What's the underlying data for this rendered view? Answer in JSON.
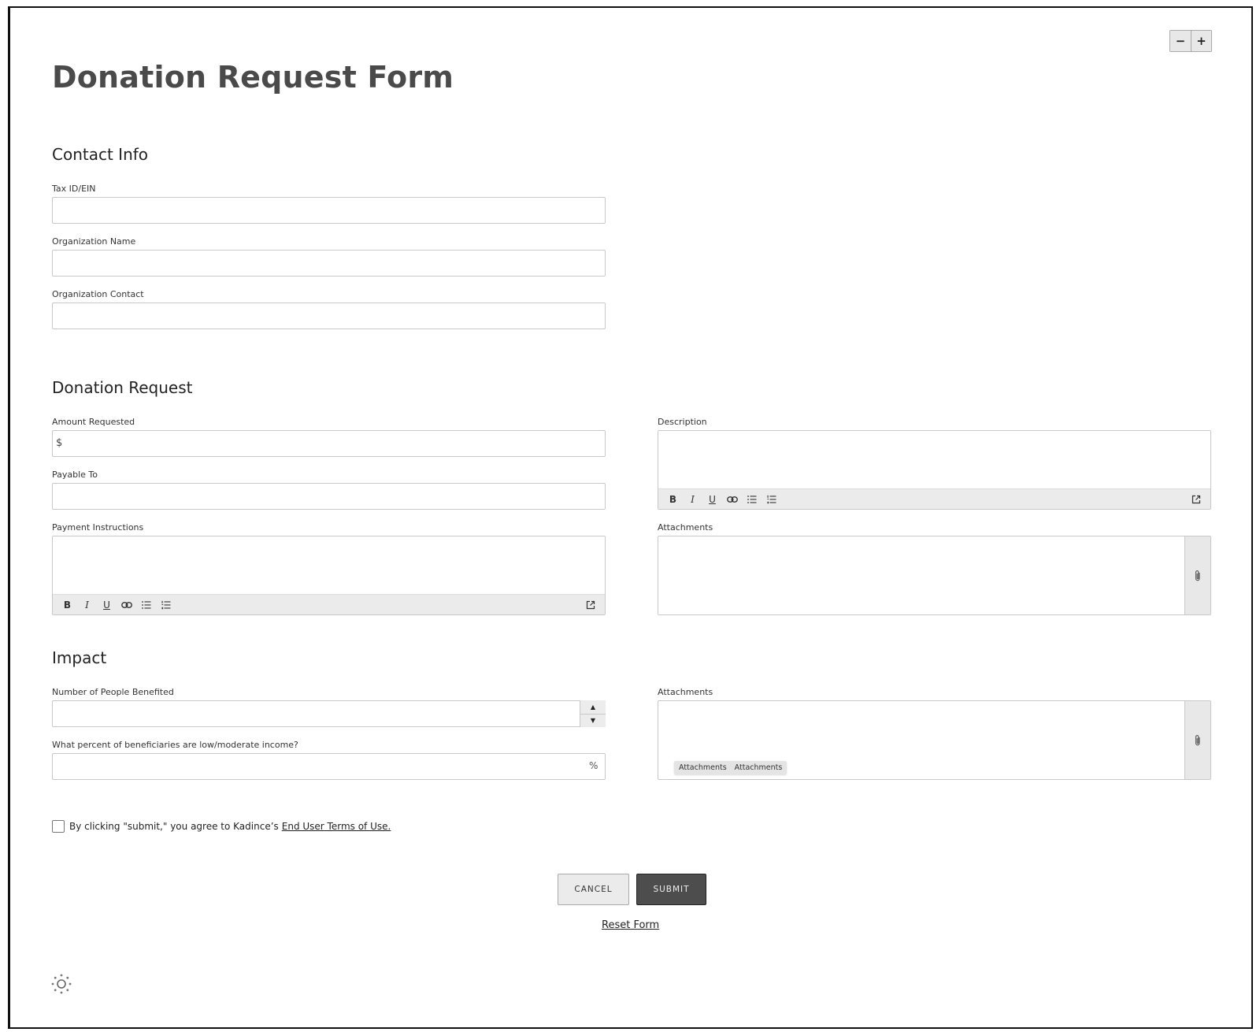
{
  "zoom": {
    "minus_label": "−",
    "plus_label": "+"
  },
  "page": {
    "title": "Donation Request Form"
  },
  "sections": {
    "contact": {
      "title": "Contact Info",
      "fields": {
        "tax_id": {
          "label": "Tax ID/EIN",
          "value": ""
        },
        "org_name": {
          "label": "Organization Name",
          "value": ""
        },
        "org_contact": {
          "label": "Organization Contact",
          "value": ""
        }
      }
    },
    "donation": {
      "title": "Donation Request",
      "fields": {
        "amount": {
          "label": "Amount Requested",
          "prefix": "$",
          "value": ""
        },
        "payable_to": {
          "label": "Payable To",
          "value": ""
        },
        "payment_instructions": {
          "label": "Payment Instructions",
          "value": ""
        },
        "description": {
          "label": "Description",
          "value": ""
        },
        "attachments": {
          "label": "Attachments"
        }
      }
    },
    "impact": {
      "title": "Impact",
      "fields": {
        "people_benefited": {
          "label": "Number of People Benefited",
          "value": ""
        },
        "percent_low_income": {
          "label": "What percent of beneficiaries are low/moderate income?",
          "suffix": "%",
          "value": ""
        },
        "attachments": {
          "label": "Attachments",
          "chips": [
            "Attachments",
            "Attachments"
          ]
        }
      }
    }
  },
  "toolbar": {
    "bold": "B",
    "italic": "I",
    "underline": "U",
    "icons": [
      "bold-icon",
      "italic-icon",
      "underline-icon",
      "link-icon",
      "bulleted-list-icon",
      "numbered-list-icon",
      "expand-icon"
    ]
  },
  "consent": {
    "text": "By clicking \"submit,\" you agree to Kadince’s",
    "link": "End User Terms of Use."
  },
  "actions": {
    "cancel": "CANCEL",
    "submit": "SUBMIT",
    "reset": "Reset Form"
  }
}
